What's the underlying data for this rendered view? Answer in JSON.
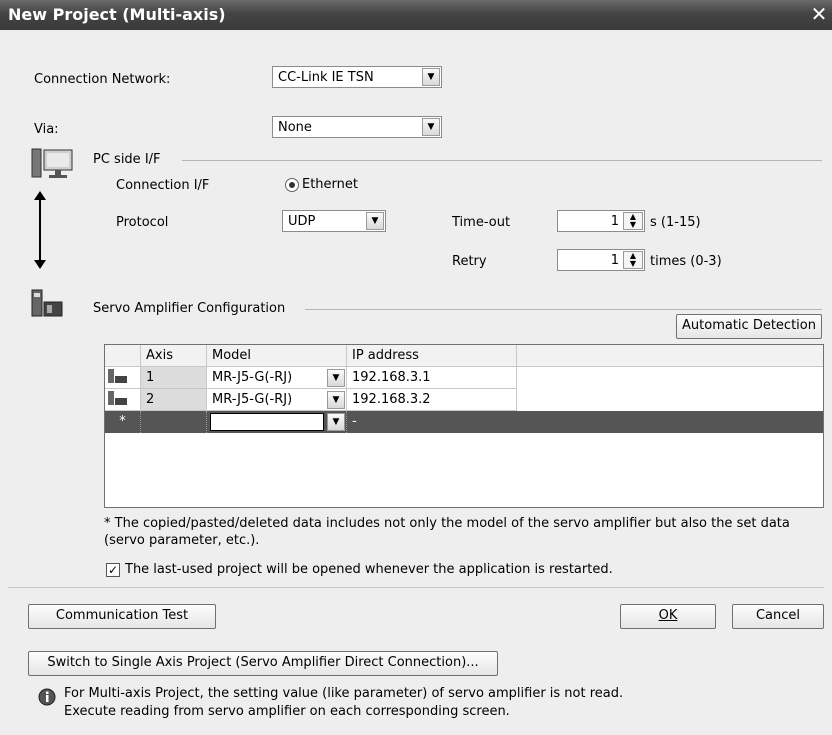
{
  "window": {
    "title": "New Project (Multi-axis)"
  },
  "connection_network": {
    "label": "Connection Network:",
    "value": "CC-Link IE TSN"
  },
  "via": {
    "label": "Via:",
    "value": "None"
  },
  "pc_side": {
    "group_label": "PC side I/F",
    "connection_if_label": "Connection I/F",
    "connection_if_value": "Ethernet",
    "protocol_label": "Protocol",
    "protocol_value": "UDP",
    "timeout_label": "Time-out",
    "timeout_value": "1",
    "timeout_unit": "s (1-15)",
    "retry_label": "Retry",
    "retry_value": "1",
    "retry_unit": "times (0-3)"
  },
  "servo": {
    "group_label": "Servo Amplifier Configuration",
    "auto_detect_label": "Automatic Detection",
    "columns": [
      "Axis",
      "Model",
      "IP address"
    ],
    "rows": [
      {
        "axis": "1",
        "model": "MR-J5-G(-RJ)",
        "ip": "192.168.3.1"
      },
      {
        "axis": "2",
        "model": "MR-J5-G(-RJ)",
        "ip": "192.168.3.2"
      }
    ],
    "new_row": {
      "marker": "*",
      "ip": "-"
    }
  },
  "note": {
    "line1": "* The copied/pasted/deleted data includes not only the model of the servo amplifier but also the set data",
    "line2": "(servo parameter, etc.)."
  },
  "last_used": {
    "label": "The last-used project will be opened whenever the application is restarted.",
    "checked": true
  },
  "buttons": {
    "comm_test": "Communication Test",
    "ok": "OK",
    "cancel": "Cancel",
    "switch": "Switch to Single Axis Project (Servo Amplifier Direct Connection)..."
  },
  "info": {
    "line1": "For Multi-axis Project, the setting value (like parameter) of servo amplifier is not read.",
    "line2": "Execute reading from servo amplifier on each corresponding screen."
  }
}
